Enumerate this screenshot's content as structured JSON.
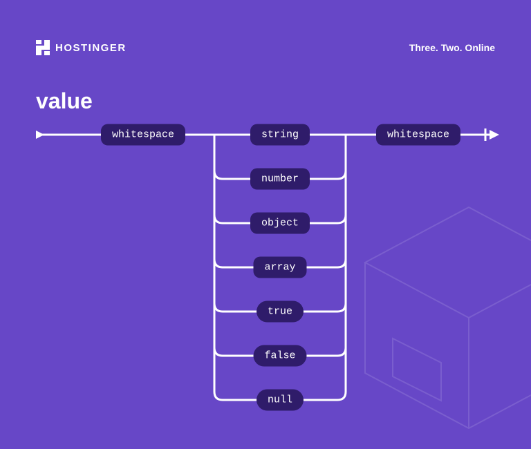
{
  "header": {
    "brand": "HOSTINGER",
    "tagline": "Three. Two. Online"
  },
  "title": "value",
  "diagram": {
    "whitespace_left": "whitespace",
    "whitespace_right": "whitespace",
    "branches": [
      "string",
      "number",
      "object",
      "array",
      "true",
      "false",
      "null"
    ]
  }
}
